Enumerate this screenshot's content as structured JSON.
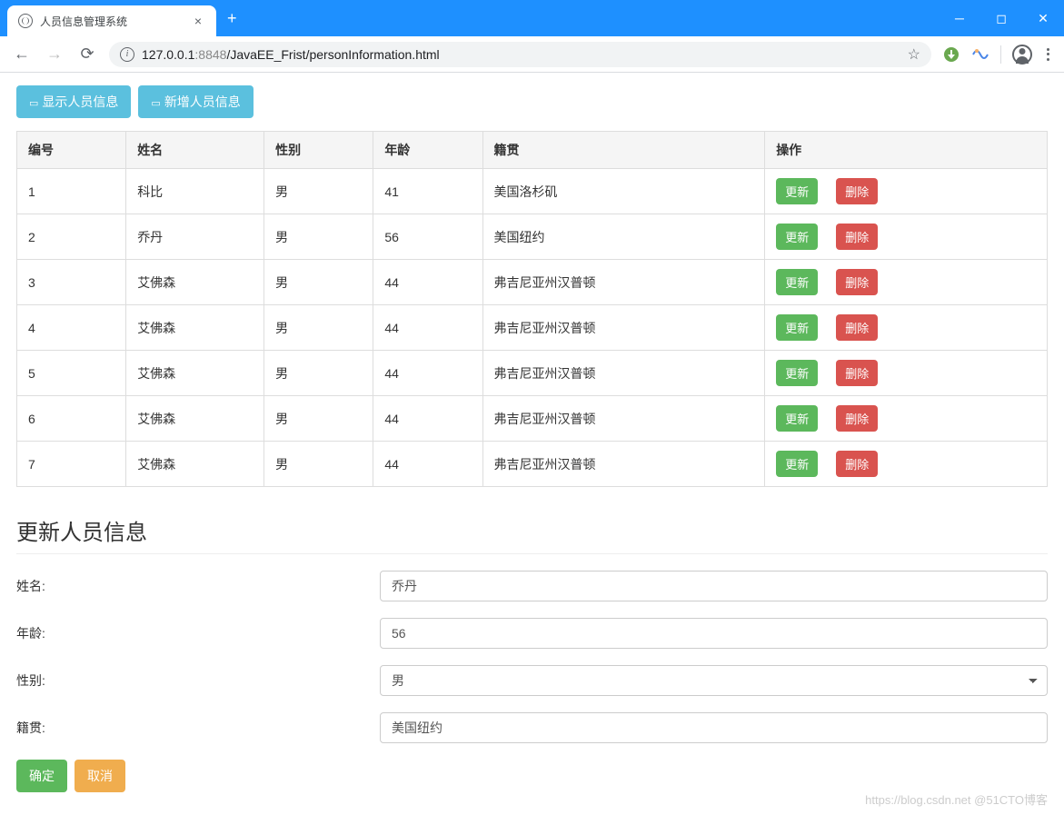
{
  "browser": {
    "tab_title": "人员信息管理系统",
    "url_host": "127.0.0.1",
    "url_port": ":8848",
    "url_path": "/JavaEE_Frist/personInformation.html"
  },
  "actions": {
    "show_label": "显示人员信息",
    "add_label": "新增人员信息"
  },
  "table": {
    "headers": [
      "编号",
      "姓名",
      "性别",
      "年龄",
      "籍贯",
      "操作"
    ],
    "update_label": "更新",
    "delete_label": "删除",
    "rows": [
      {
        "id": "1",
        "name": "科比",
        "gender": "男",
        "age": "41",
        "origin": "美国洛杉矶"
      },
      {
        "id": "2",
        "name": "乔丹",
        "gender": "男",
        "age": "56",
        "origin": "美国纽约"
      },
      {
        "id": "3",
        "name": "艾佛森",
        "gender": "男",
        "age": "44",
        "origin": "弗吉尼亚州汉普顿"
      },
      {
        "id": "4",
        "name": "艾佛森",
        "gender": "男",
        "age": "44",
        "origin": "弗吉尼亚州汉普顿"
      },
      {
        "id": "5",
        "name": "艾佛森",
        "gender": "男",
        "age": "44",
        "origin": "弗吉尼亚州汉普顿"
      },
      {
        "id": "6",
        "name": "艾佛森",
        "gender": "男",
        "age": "44",
        "origin": "弗吉尼亚州汉普顿"
      },
      {
        "id": "7",
        "name": "艾佛森",
        "gender": "男",
        "age": "44",
        "origin": "弗吉尼亚州汉普顿"
      }
    ]
  },
  "form": {
    "title": "更新人员信息",
    "labels": {
      "name": "姓名:",
      "age": "年龄:",
      "gender": "性别:",
      "origin": "籍贯:"
    },
    "values": {
      "name": "乔丹",
      "age": "56",
      "gender": "男",
      "origin": "美国纽约"
    },
    "confirm_label": "确定",
    "cancel_label": "取消"
  },
  "watermark": "https://blog.csdn.net @51CTO博客"
}
